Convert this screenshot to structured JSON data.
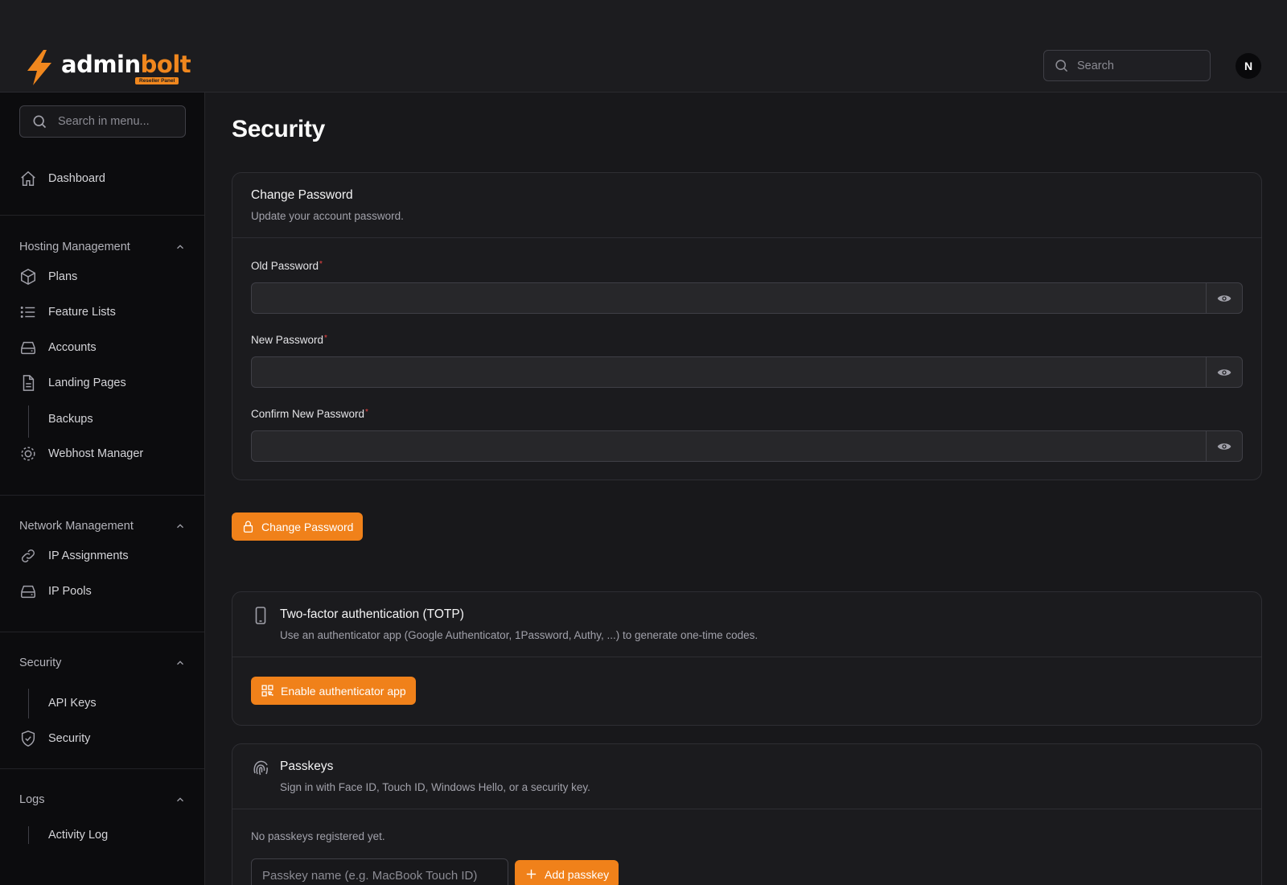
{
  "brand": {
    "name_part1": "admin",
    "name_part2": "bolt",
    "badge": "Reseller Panel",
    "accent": "#f0811a"
  },
  "header": {
    "search_placeholder": "Search",
    "avatar_initial": "N"
  },
  "sidebar": {
    "search_placeholder": "Search in menu...",
    "dashboard": "Dashboard",
    "groups": [
      {
        "title": "Hosting Management",
        "items": [
          "Plans",
          "Feature Lists",
          "Accounts",
          "Landing Pages",
          "Backups",
          "Webhost Manager"
        ]
      },
      {
        "title": "Network Management",
        "items": [
          "IP Assignments",
          "IP Pools"
        ]
      },
      {
        "title": "Security",
        "items": [
          "API Keys",
          "Security"
        ]
      },
      {
        "title": "Logs",
        "items": [
          "Activity Log"
        ]
      }
    ]
  },
  "page": {
    "title": "Security"
  },
  "change_password": {
    "title": "Change Password",
    "subtitle": "Update your account password.",
    "fields": [
      "Old Password",
      "New Password",
      "Confirm New Password"
    ],
    "required_mark": "*",
    "button": "Change Password"
  },
  "totp": {
    "title": "Two-factor authentication (TOTP)",
    "subtitle": "Use an authenticator app (Google Authenticator, 1Password, Authy, ...) to generate one-time codes.",
    "button": "Enable authenticator app"
  },
  "passkeys": {
    "title": "Passkeys",
    "subtitle": "Sign in with Face ID, Touch ID, Windows Hello, or a security key.",
    "empty": "No passkeys registered yet.",
    "input_placeholder": "Passkey name (e.g. MacBook Touch ID)",
    "button": "Add passkey"
  }
}
